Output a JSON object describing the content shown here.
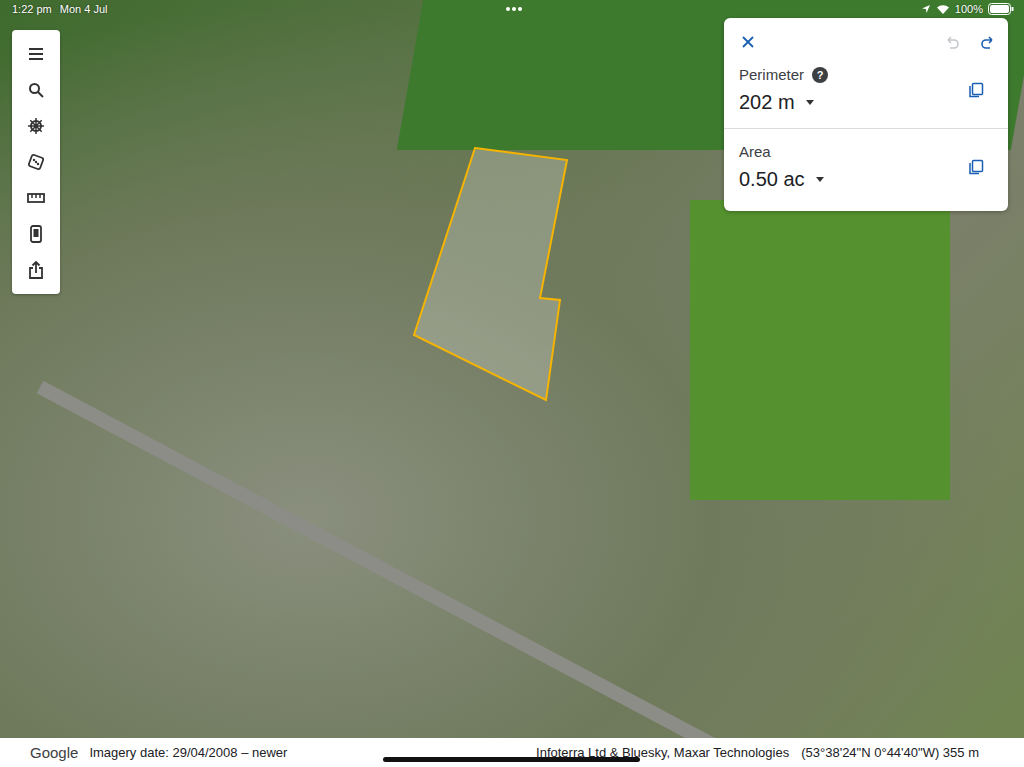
{
  "status_bar": {
    "time": "1:22 pm",
    "date": "Mon 4 Jul",
    "battery": "100%"
  },
  "measure_panel": {
    "undo": {
      "disabled": true
    },
    "redo": {
      "disabled": false
    },
    "rows": [
      {
        "label": "Perimeter",
        "help": "?",
        "value": "202 m"
      },
      {
        "label": "Area",
        "value": "0.50 ac"
      }
    ]
  },
  "footer": {
    "logo": "Google",
    "imagery_date": "Imagery date: 29/04/2008 – newer",
    "attribution": "Infoterra Ltd & Bluesky, Maxar Technologies",
    "coordinates": "(53°38'24\"N 0°44'40\"W) 355 m"
  }
}
